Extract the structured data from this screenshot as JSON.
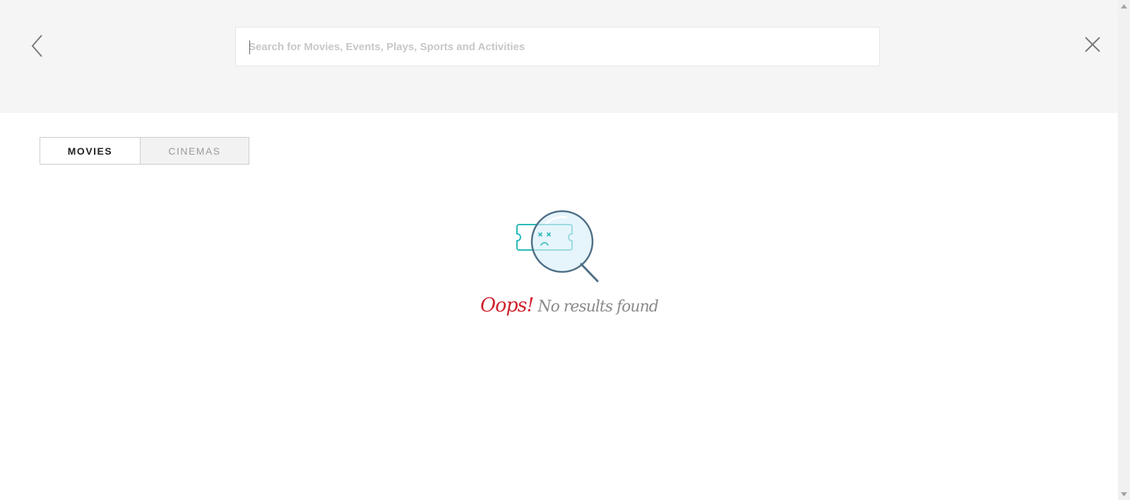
{
  "header": {
    "back_icon": "chevron-left-icon",
    "close_icon": "close-icon",
    "search": {
      "placeholder": "Search for Movies, Events, Plays, Sports and Activities",
      "value": ""
    }
  },
  "tabs": [
    {
      "label": "MOVIES",
      "active": true
    },
    {
      "label": "CINEMAS",
      "active": false
    }
  ],
  "empty_state": {
    "illustration_icon": "ticket-magnifier-icon",
    "oops_text": "Oops!",
    "message_text": "No results found",
    "accent_color": "#d0232e"
  },
  "colors": {
    "header_bg": "#f5f5f5",
    "ticket_teal": "#2ab8b8",
    "magnifier_blue": "#4f6f86"
  }
}
